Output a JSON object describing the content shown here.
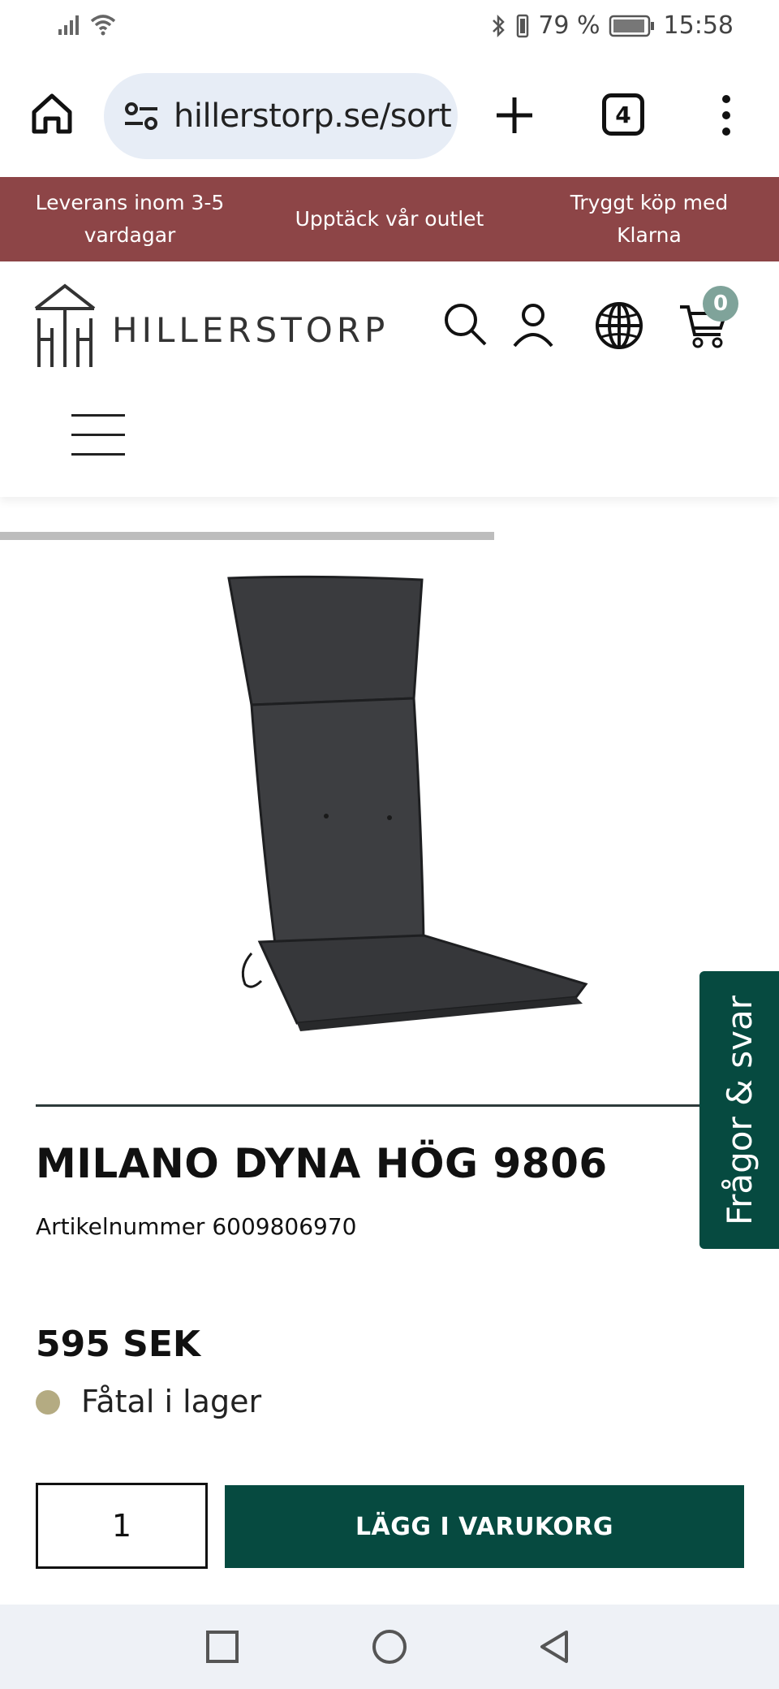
{
  "status_bar": {
    "battery_percent": "79 %",
    "time": "15:58",
    "icons": [
      "signal-icon",
      "wifi-icon",
      "bluetooth-icon",
      "vibrate-icon",
      "battery-icon"
    ]
  },
  "browser": {
    "url": "hillerstorp.se/sort",
    "tab_count": "4",
    "icons": [
      "home-icon",
      "site-settings-icon",
      "plus-icon",
      "more-icon"
    ]
  },
  "promo": {
    "items": [
      "Leverans inom 3-5 vardagar",
      "Upptäck vår outlet",
      "Tryggt köp med Klarna"
    ],
    "background_color": "#8d4547"
  },
  "header": {
    "logo_text": "HILLERSTORP",
    "cart_count": "0",
    "icons": [
      "search-icon",
      "user-icon",
      "globe-icon",
      "cart-icon",
      "menu-icon"
    ]
  },
  "product": {
    "title": "MILANO DYNA HÖG 9806",
    "article_number": "Artikelnummer 6009806970",
    "price": "595 SEK",
    "stock_status": "Fåtal i lager",
    "stock_color": "#b4ab82",
    "quantity": "1",
    "add_to_cart_label": "LÄGG I VARUKORG",
    "accent_color": "#064a40"
  },
  "faq_tab": {
    "label": "Frågor & svar"
  }
}
